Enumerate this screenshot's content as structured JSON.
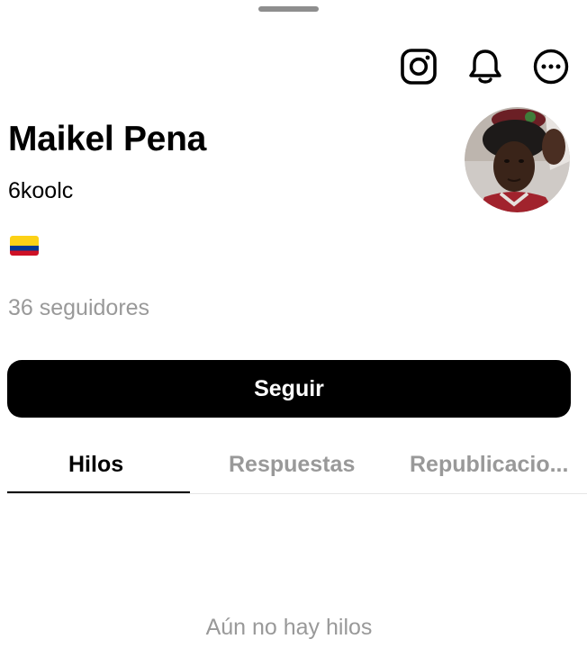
{
  "sheet": {
    "grabber_icon": "drag-handle"
  },
  "header_actions": {
    "instagram_icon": "instagram-icon",
    "notifications_icon": "bell-icon",
    "more_icon": "more-horizontal-icon"
  },
  "profile": {
    "name": "Maikel Pena",
    "username": "6koolc",
    "bio_flag": "colombia-flag-icon",
    "followers_text": "36 seguidores",
    "avatar": "profile-photo"
  },
  "actions": {
    "follow_label": "Seguir"
  },
  "tabs": [
    {
      "label": "Hilos",
      "active": true
    },
    {
      "label": "Respuestas",
      "active": false
    },
    {
      "label": "Republicacio...",
      "active": false
    }
  ],
  "empty_state": {
    "message": "Aún no hay hilos"
  },
  "colors": {
    "primary_text": "#000000",
    "secondary_text": "#999999",
    "button_bg": "#000000",
    "button_text": "#ffffff",
    "flag_yellow": "#FCD116",
    "flag_blue": "#003893",
    "flag_red": "#CE1126"
  }
}
